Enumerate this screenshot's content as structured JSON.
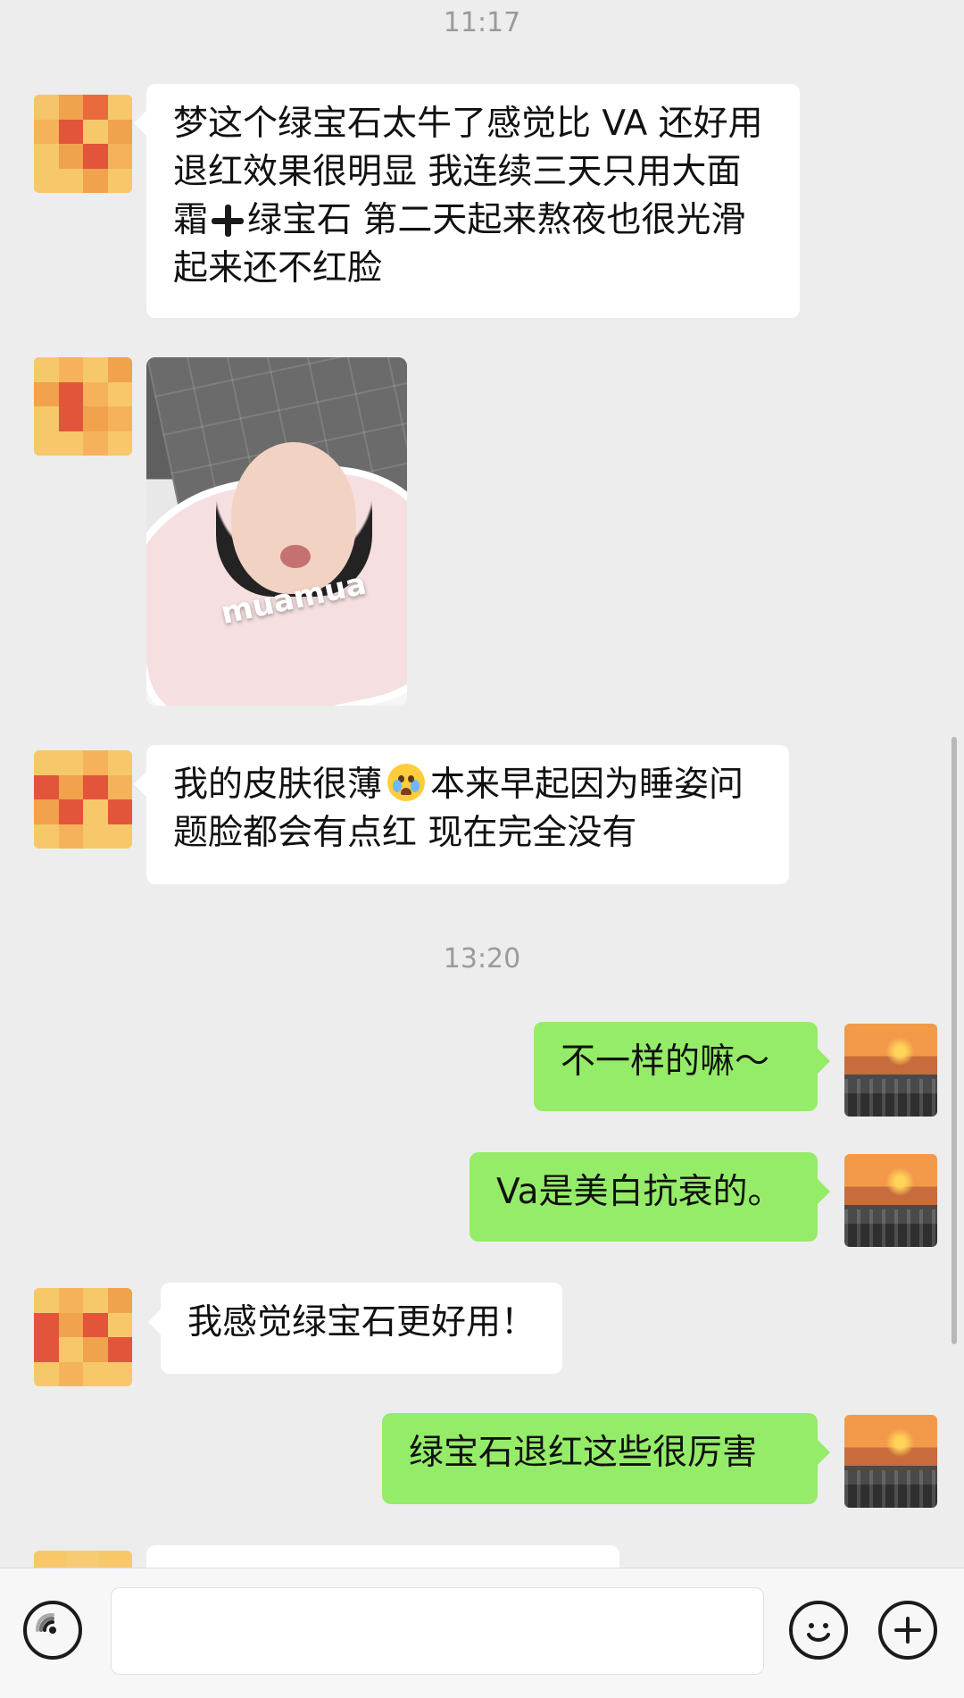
{
  "timestamps": {
    "t1": "11:17",
    "t2": "13:20"
  },
  "messages": {
    "m1": {
      "sender": "contact",
      "text_part1": "梦这个绿宝石太牛了感觉比 VA 还好用 退红效果很明显 我连续三天只用大面霜",
      "icon": "heavy-plus-sign-icon",
      "text_part2": "绿宝石 第二天起来熬夜也很光滑 起来还不红脸"
    },
    "m2": {
      "sender": "contact",
      "sticker_text": "muamua"
    },
    "m3": {
      "sender": "contact",
      "text_part1": "我的皮肤很薄",
      "icon": "crying-face-emoji",
      "text_part2": "本来早起因为睡姿问题脸都会有点红 现在完全没有"
    },
    "m4": {
      "sender": "me",
      "text": "不一样的嘛～"
    },
    "m5": {
      "sender": "me",
      "text": "Va是美白抗衰的。"
    },
    "m6": {
      "sender": "contact",
      "text": "我感觉绿宝石更好用！"
    },
    "m7": {
      "sender": "me",
      "text": "绿宝石退红这些很厉害"
    }
  },
  "input_bar": {
    "voice_icon": "voice-icon",
    "emoji_icon": "emoji-icon",
    "plus_icon": "plus-icon"
  },
  "colors": {
    "background": "#ededed",
    "left_bubble": "#ffffff",
    "right_bubble": "#95ec69",
    "timestamp": "#9a9a9a"
  }
}
